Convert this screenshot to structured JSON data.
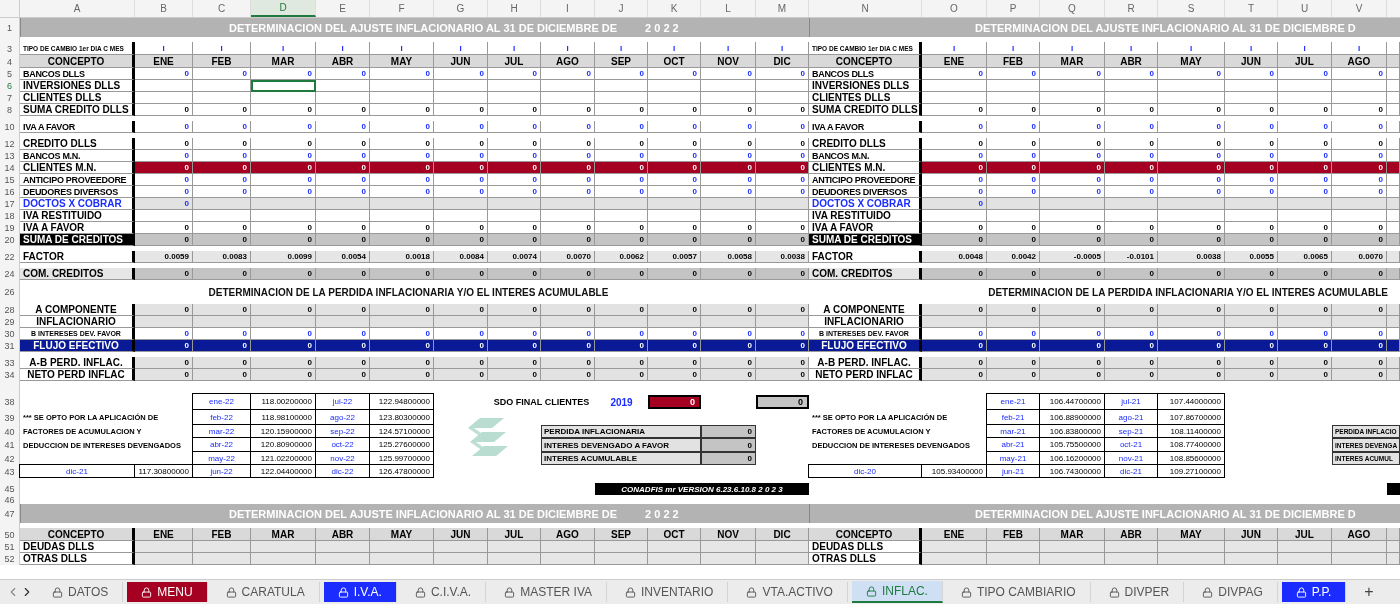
{
  "columns": [
    {
      "letter": "A",
      "selected": false
    },
    {
      "letter": "B",
      "selected": false
    },
    {
      "letter": "C",
      "selected": false
    },
    {
      "letter": "D",
      "selected": true
    },
    {
      "letter": "E",
      "selected": false
    },
    {
      "letter": "F",
      "selected": false
    },
    {
      "letter": "G",
      "selected": false
    },
    {
      "letter": "H",
      "selected": false
    },
    {
      "letter": "I",
      "selected": false
    },
    {
      "letter": "J",
      "selected": false
    },
    {
      "letter": "K",
      "selected": false
    },
    {
      "letter": "L",
      "selected": false
    },
    {
      "letter": "M",
      "selected": false
    },
    {
      "letter": "N",
      "selected": false
    },
    {
      "letter": "O",
      "selected": false
    },
    {
      "letter": "P",
      "selected": false
    },
    {
      "letter": "Q",
      "selected": false
    },
    {
      "letter": "R",
      "selected": false
    },
    {
      "letter": "S",
      "selected": false
    },
    {
      "letter": "T",
      "selected": false
    },
    {
      "letter": "U",
      "selected": false
    },
    {
      "letter": "V",
      "selected": false
    }
  ],
  "rows": [
    {
      "kind": "title",
      "number": "1",
      "selected": false,
      "left": {
        "title": "DETERMINACION DEL AJUSTE INFLACIONARIO AL 31 DE DICIEMBRE DE",
        "year": "2 0 2 2"
      },
      "right": {
        "title": "DETERMINACION DEL AJUSTE INFLACIONARIO AL 31 DE DICIEMBRE D"
      }
    },
    {
      "kind": "gap"
    },
    {
      "kind": "rate",
      "number": "3",
      "selected": false,
      "left": {
        "label": "TIPO DE CAMBIO 1er DIA C MES",
        "values": [
          "I",
          "I",
          "I",
          "I",
          "I",
          "I",
          "I",
          "I",
          "I",
          "I",
          "I",
          "I"
        ]
      },
      "right": {
        "label": "TIPO DE CAMBIO 1er DIA C MES",
        "values": [
          "I",
          "I",
          "I",
          "I",
          "I",
          "I",
          "I",
          "I"
        ]
      }
    },
    {
      "kind": "header",
      "number": "4",
      "selected": false,
      "left": {
        "label": "CONCEPTO",
        "values": [
          "ENE",
          "FEB",
          "MAR",
          "ABR",
          "MAY",
          "JUN",
          "JUL",
          "AGO",
          "SEP",
          "OCT",
          "NOV",
          "DIC"
        ]
      },
      "right": {
        "label": "CONCEPTO",
        "values": [
          "ENE",
          "FEB",
          "MAR",
          "ABR",
          "MAY",
          "JUN",
          "JUL",
          "AGO"
        ]
      }
    },
    {
      "kind": "input",
      "number": "5",
      "selected": false,
      "left": {
        "label": "BANCOS DLLS",
        "values": [
          "0",
          "0",
          "0",
          "0",
          "0",
          "0",
          "0",
          "0",
          "0",
          "0",
          "0",
          "0"
        ]
      },
      "right": {
        "label": "BANCOS DLLS",
        "values": [
          "0",
          "0",
          "0",
          "0",
          "0",
          "0",
          "0",
          "0"
        ]
      }
    },
    {
      "kind": "blank",
      "number": "6",
      "selected": true,
      "left": {
        "label": "INVERSIONES DLLS"
      },
      "right": {
        "label": "INVERSIONES DLLS"
      }
    },
    {
      "kind": "blank",
      "number": "7",
      "selected": false,
      "left": {
        "label": "CLIENTES DLLS"
      },
      "right": {
        "label": "CLIENTES DLLS"
      }
    },
    {
      "kind": "sum",
      "number": "8",
      "selected": false,
      "left": {
        "label": "SUMA CREDITO DLLS",
        "values": [
          "0",
          "0",
          "0",
          "0",
          "0",
          "0",
          "0",
          "0",
          "0",
          "0",
          "0",
          "0"
        ]
      },
      "right": {
        "label": "SUMA CREDITO DLLS",
        "values": [
          "0",
          "0",
          "0",
          "0",
          "0",
          "0",
          "0",
          "0"
        ]
      }
    },
    {
      "kind": "gap"
    },
    {
      "kind": "input",
      "number": "10",
      "selected": false,
      "left": {
        "label": "IVA A FAVOR",
        "values": [
          "0",
          "0",
          "0",
          "0",
          "0",
          "0",
          "0",
          "0",
          "0",
          "0",
          "0",
          "0"
        ]
      },
      "right": {
        "label": "IVA A FAVOR",
        "values": [
          "0",
          "0",
          "0",
          "0",
          "0",
          "0",
          "0",
          "0"
        ]
      }
    },
    {
      "kind": "gap"
    },
    {
      "kind": "sum",
      "number": "12",
      "selected": false,
      "left": {
        "label": "CREDITO DLLS",
        "values": [
          "0",
          "0",
          "0",
          "0",
          "0",
          "0",
          "0",
          "0",
          "0",
          "0",
          "0",
          "0"
        ]
      },
      "right": {
        "label": "CREDITO DLLS",
        "values": [
          "0",
          "0",
          "0",
          "0",
          "0",
          "0",
          "0",
          "0"
        ]
      }
    },
    {
      "kind": "input",
      "number": "13",
      "selected": false,
      "left": {
        "label": "BANCOS M.N.",
        "values": [
          "0",
          "0",
          "0",
          "0",
          "0",
          "0",
          "0",
          "0",
          "0",
          "0",
          "0",
          "0"
        ]
      },
      "right": {
        "label": "BANCOS M.N.",
        "values": [
          "0",
          "0",
          "0",
          "0",
          "0",
          "0",
          "0",
          "0"
        ]
      }
    },
    {
      "kind": "red",
      "number": "14",
      "selected": false,
      "left": {
        "label": "CLIENTES M.N.",
        "values": [
          "0",
          "0",
          "0",
          "0",
          "0",
          "0",
          "0",
          "0",
          "0",
          "0",
          "0",
          "0"
        ]
      },
      "right": {
        "label": "CLIENTES M.N.",
        "values": [
          "0",
          "0",
          "0",
          "0",
          "0",
          "0",
          "0",
          "0"
        ]
      }
    },
    {
      "kind": "input",
      "number": "15",
      "selected": false,
      "left": {
        "label": "ANTICIPO PROVEEDORE",
        "values": [
          "0",
          "0",
          "0",
          "0",
          "0",
          "0",
          "0",
          "0",
          "0",
          "0",
          "0",
          "0"
        ]
      },
      "right": {
        "label": "ANTICIPO PROVEEDORE",
        "values": [
          "0",
          "0",
          "0",
          "0",
          "0",
          "0",
          "0",
          "0"
        ]
      }
    },
    {
      "kind": "input",
      "number": "16",
      "selected": false,
      "left": {
        "label": "DEUDORES DIVERSOS",
        "values": [
          "0",
          "0",
          "0",
          "0",
          "0",
          "0",
          "0",
          "0",
          "0",
          "0",
          "0",
          "0"
        ]
      },
      "right": {
        "label": "DEUDORES DIVERSOS",
        "values": [
          "0",
          "0",
          "0",
          "0",
          "0",
          "0",
          "0",
          "0"
        ]
      }
    },
    {
      "kind": "linked",
      "number": "17",
      "selected": false,
      "left": {
        "label": "DOCTOS X COBRAR",
        "values": [
          "0"
        ]
      },
      "right": {
        "label": "DOCTOS X COBRAR",
        "values": [
          "0"
        ]
      }
    },
    {
      "kind": "blank",
      "number": "18",
      "selected": false,
      "left": {
        "label": "IVA RESTITUIDO"
      },
      "right": {
        "label": "IVA RESTITUIDO"
      }
    },
    {
      "kind": "sum",
      "number": "19",
      "selected": false,
      "left": {
        "label": "IVA A FAVOR",
        "values": [
          "0",
          "0",
          "0",
          "0",
          "0",
          "0",
          "0",
          "0",
          "0",
          "0",
          "0",
          "0"
        ]
      },
      "right": {
        "label": "IVA A FAVOR",
        "values": [
          "0",
          "0",
          "0",
          "0",
          "0",
          "0",
          "0",
          "0"
        ]
      }
    },
    {
      "kind": "total",
      "number": "20",
      "selected": false,
      "left": {
        "label": "SUMA DE CREDITOS",
        "values": [
          "0",
          "0",
          "0",
          "0",
          "0",
          "0",
          "0",
          "0",
          "0",
          "0",
          "0",
          "0"
        ]
      },
      "right": {
        "label": "SUMA DE CREDITOS",
        "values": [
          "0",
          "0",
          "0",
          "0",
          "0",
          "0",
          "0",
          "0"
        ]
      }
    },
    {
      "kind": "gap"
    },
    {
      "kind": "factor",
      "number": "22",
      "selected": false,
      "left": {
        "label": "FACTOR",
        "values": [
          "0.0059",
          "0.0083",
          "0.0099",
          "0.0054",
          "0.0018",
          "0.0084",
          "0.0074",
          "0.0070",
          "0.0062",
          "0.0057",
          "0.0058",
          "0.0038"
        ]
      },
      "right": {
        "label": "FACTOR",
        "values": [
          "0.0048",
          "0.0042",
          "-0.0005",
          "-0.0101",
          "0.0038",
          "0.0055",
          "0.0065",
          "0.0070"
        ]
      }
    },
    {
      "kind": "gap"
    },
    {
      "kind": "gray",
      "number": "24",
      "selected": false,
      "left": {
        "label": "COM. CREDITOS",
        "values": [
          "0",
          "0",
          "0",
          "0",
          "0",
          "0",
          "0",
          "0",
          "0",
          "0",
          "0",
          "0"
        ]
      },
      "right": {
        "label": "COM. CREDITOS",
        "values": [
          "0",
          "0",
          "0",
          "0",
          "0",
          "0",
          "0",
          "0"
        ]
      }
    },
    {
      "kind": "gap"
    },
    {
      "kind": "section",
      "number": "26",
      "selected": false,
      "left": {
        "title": "DETERMINACION DE LA PERDIDA INFLACIONARIA Y/O EL INTERES ACUMULABLE"
      },
      "right": {
        "title": "DETERMINACION DE LA PERDIDA INFLACIONARIA Y/O EL INTERES ACUMULABLE"
      }
    },
    {
      "kind": "gap"
    },
    {
      "kind": "component",
      "number": "28",
      "selected": false,
      "left": {
        "label": "A COMPONENTE",
        "values": [
          "0",
          "0",
          "0",
          "0",
          "0",
          "0",
          "0",
          "0",
          "0",
          "0",
          "0",
          "0"
        ]
      },
      "right": {
        "label": "A COMPONENTE",
        "values": [
          "0",
          "0",
          "0",
          "0",
          "0",
          "0",
          "0",
          "0"
        ]
      }
    },
    {
      "kind": "component",
      "number": "29",
      "selected": false,
      "left": {
        "label": "INFLACIONARIO"
      },
      "right": {
        "label": "INFLACIONARIO"
      }
    },
    {
      "kind": "small",
      "number": "30",
      "selected": false,
      "left": {
        "label": "B INTERESES DEV. FAVOR",
        "values": [
          "0",
          "0",
          "0",
          "0",
          "0",
          "0",
          "0",
          "0",
          "0",
          "0",
          "0",
          "0"
        ]
      },
      "right": {
        "label": "B INTERESES DEV. FAVOR",
        "values": [
          "0",
          "0",
          "0",
          "0",
          "0",
          "0",
          "0",
          "0"
        ]
      }
    },
    {
      "kind": "flow",
      "number": "31",
      "selected": false,
      "left": {
        "label": "FLUJO EFECTIVO",
        "values": [
          "0",
          "0",
          "0",
          "0",
          "0",
          "0",
          "0",
          "0",
          "0",
          "0",
          "0",
          "0"
        ]
      },
      "right": {
        "label": "FLUJO EFECTIVO",
        "values": [
          "0",
          "0",
          "0",
          "0",
          "0",
          "0",
          "0",
          "0"
        ]
      }
    },
    {
      "kind": "gap"
    },
    {
      "kind": "perd",
      "number": "33",
      "selected": false,
      "left": {
        "label": "A-B PERD. INFLAC.",
        "values": [
          "0",
          "0",
          "0",
          "0",
          "0",
          "0",
          "0",
          "0",
          "0",
          "0",
          "0",
          "0"
        ]
      },
      "right": {
        "label": "A-B PERD. INFLAC.",
        "values": [
          "0",
          "0",
          "0",
          "0",
          "0",
          "0",
          "0",
          "0"
        ]
      }
    },
    {
      "kind": "perd",
      "number": "34",
      "selected": false,
      "left": {
        "label": "NETO PERD INFLAC",
        "values": [
          "0",
          "0",
          "0",
          "0",
          "0",
          "0",
          "0",
          "0",
          "0",
          "0",
          "0",
          "0"
        ]
      },
      "right": {
        "label": "NETO PERD INFLAC",
        "values": [
          "0",
          "0",
          "0",
          "0",
          "0",
          "0",
          "0",
          "0"
        ]
      }
    },
    {
      "kind": "wide_gap"
    }
  ],
  "notes": {
    "numbers": [
      "38",
      "39",
      "40",
      "41",
      "42",
      "43",
      "45",
      "46"
    ],
    "left": {
      "lines": [
        "*** SE OPTO POR LA APLICACIÓN DE",
        "FACTORES DE ACUMULACION Y",
        "DEDUCCION DE INTERESES DEVENGADOS"
      ],
      "base": {
        "month": "dic-21",
        "value": "117.30800000"
      },
      "index_rows": [
        {
          "m1": "ene-22",
          "v1": "118.00200000",
          "m2": "jul-22",
          "v2": "122.94800000"
        },
        {
          "m1": "feb-22",
          "v1": "118.98100000",
          "m2": "ago-22",
          "v2": "123.80300000"
        },
        {
          "m1": "mar-22",
          "v1": "120.15900000",
          "m2": "sep-22",
          "v2": "124.57100000"
        },
        {
          "m1": "abr-22",
          "v1": "120.80900000",
          "m2": "oct-22",
          "v2": "125.27600000"
        },
        {
          "m1": "may-22",
          "v1": "121.02200000",
          "m2": "nov-22",
          "v2": "125.99700000"
        },
        {
          "m1": "jun-22",
          "v1": "122.04400000",
          "m2": "dic-22",
          "v2": "126.47800000"
        }
      ],
      "sdo": {
        "label": "SDO FINAL CLIENTES",
        "year": "2019",
        "value": "0",
        "second_value": "0"
      },
      "summary": [
        {
          "label": "PERDIDA INFLACIONARIA",
          "value": "0"
        },
        {
          "label": "INTERES DEVENGADO A FAVOR",
          "value": "0"
        },
        {
          "label": "INTERES ACUMULABLE",
          "value": "0"
        }
      ],
      "version": "CONADFIS mr VERSION 6.23.6.10.8  2 0 2 3"
    },
    "right": {
      "lines": [
        "*** SE OPTO POR LA APLICACIÓN DE",
        "FACTORES DE ACUMULACION Y",
        "DEDUCCION DE INTERESES DEVENGADOS"
      ],
      "base": {
        "month": "dic-20",
        "value": "105.93400000"
      },
      "index_rows": [
        {
          "m1": "ene-21",
          "v1": "106.44700000",
          "m2": "jul-21",
          "v2": "107.44000000"
        },
        {
          "m1": "feb-21",
          "v1": "106.88900000",
          "m2": "ago-21",
          "v2": "107.86700000"
        },
        {
          "m1": "mar-21",
          "v1": "106.83800000",
          "m2": "sep-21",
          "v2": "108.11400000"
        },
        {
          "m1": "abr-21",
          "v1": "105.75500000",
          "m2": "oct-21",
          "v2": "108.77400000"
        },
        {
          "m1": "may-21",
          "v1": "106.16200000",
          "m2": "nov-21",
          "v2": "108.85600000"
        },
        {
          "m1": "jun-21",
          "v1": "106.74300000",
          "m2": "dic-21",
          "v2": "109.27100000"
        }
      ],
      "summary": [
        {
          "label": "PERDIDA INFLACIO"
        },
        {
          "label": "INTERES DEVENGA"
        },
        {
          "label": "INTERES ACUMUL"
        }
      ]
    }
  },
  "lower_rows": [
    {
      "kind": "title",
      "number": "47",
      "selected": false,
      "left": {
        "title": "DETERMINACION DEL AJUSTE INFLACIONARIO AL 31 DE DICIEMBRE DE",
        "year": "2 0 2 2"
      },
      "right": {
        "title": "DETERMINACION DEL AJUSTE INFLACIONARIO AL 31 DE DICIEMBRE D"
      }
    },
    {
      "kind": "gap"
    },
    {
      "kind": "header",
      "number": "50",
      "selected": false,
      "left": {
        "label": "CONCEPTO",
        "values": [
          "ENE",
          "FEB",
          "MAR",
          "ABR",
          "MAY",
          "JUN",
          "JUL",
          "AGO",
          "SEP",
          "OCT",
          "NOV",
          "DIC"
        ]
      },
      "right": {
        "label": "CONCEPTO",
        "values": [
          "ENE",
          "FEB",
          "MAR",
          "ABR",
          "MAY",
          "JUN",
          "JUL",
          "AGO"
        ]
      }
    },
    {
      "kind": "blankgray",
      "number": "51",
      "selected": false,
      "left": {
        "label": "DEUDAS DLLS"
      },
      "right": {
        "label": "DEUDAS DLLS"
      }
    },
    {
      "kind": "blankgray",
      "number": "52",
      "selected": false,
      "left": {
        "label": "OTRAS DLLS"
      },
      "right": {
        "label": "OTRAS DLLS"
      }
    }
  ],
  "sheet_tabs": [
    {
      "label": "DATOS",
      "selected": false
    },
    {
      "label": "MENU",
      "selected": false,
      "color": "#a50021"
    },
    {
      "label": "CARATULA",
      "selected": false
    },
    {
      "label": "I.V.A.",
      "selected": false,
      "color": "#1a2cff"
    },
    {
      "label": "C.I.V.A.",
      "selected": false
    },
    {
      "label": "MASTER IVA",
      "selected": false
    },
    {
      "label": "INVENTARIO",
      "selected": false
    },
    {
      "label": "VTA.ACTIVO",
      "selected": false
    },
    {
      "label": "INFLAC.",
      "selected": true
    },
    {
      "label": "TIPO CAMBIARIO",
      "selected": false
    },
    {
      "label": "DIVPER",
      "selected": false
    },
    {
      "label": "DIVPAG",
      "selected": false
    },
    {
      "label": "P.P.",
      "selected": false,
      "color": "#1a2cff"
    }
  ],
  "add_tab": "+"
}
